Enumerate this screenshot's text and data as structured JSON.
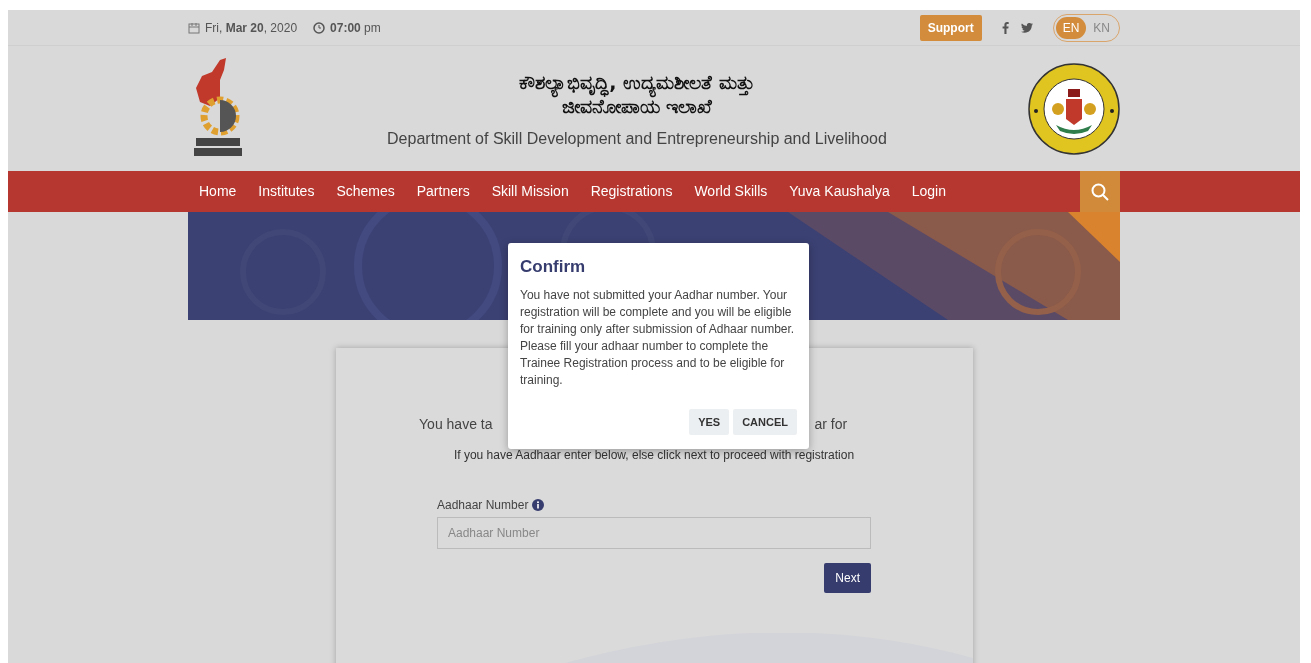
{
  "top_bar": {
    "date": "Fri, **Mar  20**, 2020",
    "time": "**07:00** pm",
    "support_button": "Support",
    "languages": [
      {
        "label": "EN",
        "selected": true
      },
      {
        "label": "KN",
        "selected": false
      }
    ]
  },
  "header": {
    "title_kannada_line_1": "ಕೌಶಲ್ಯಾಭಿವೃದ್ಧಿ, ಉದ್ಯಮಶೀಲತೆ ಮತ್ತು",
    "title_kannada_line_2": "ಜೀವನೋಪಾಯ ಇಲಾಖೆ",
    "title_english": "Department of Skill Development and Entrepreneurship and Livelihood"
  },
  "nav": {
    "items": [
      "Home",
      "Institutes",
      "Schemes",
      "Partners",
      "Skill Mission",
      "Registrations",
      "World Skills",
      "Yuva Kaushalya",
      "Login"
    ]
  },
  "card": {
    "notice_left": "You have ta",
    "notice_right": "ar for",
    "hint": "If you have Aadhaar enter below, else click next to proceed with registration",
    "field_label": "Aadhaar Number",
    "field_placeholder": "Aadhaar Number",
    "next_button": "Next"
  },
  "dialog": {
    "title": "Confirm",
    "message": "You have not submitted your Aadhar number. Your registration will be complete and you will be eligible for training only after submission of Adhaar number. Please fill your adhaar number to complete the Trainee Registration process and to be eligible for training.",
    "buttons": [
      "YES",
      "CANCEL"
    ]
  }
}
